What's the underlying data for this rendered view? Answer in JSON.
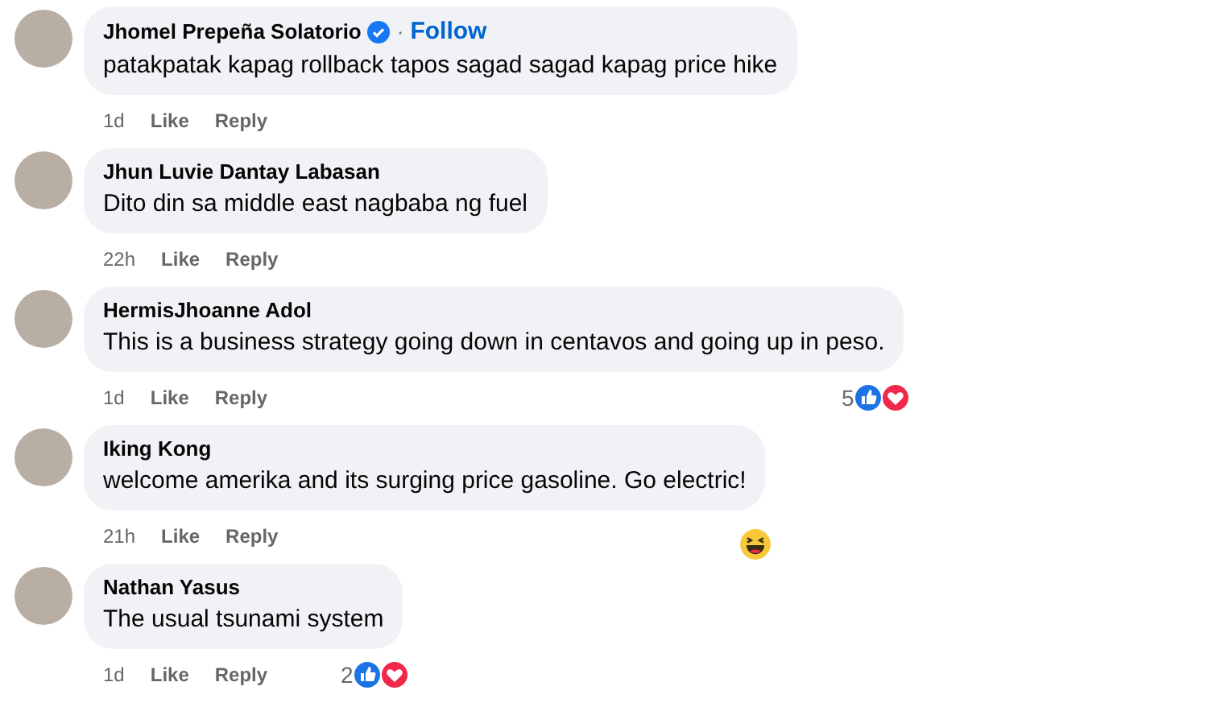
{
  "comments": [
    {
      "author": "Jhomel Prepeña Solatorio",
      "verified": true,
      "separator": "·",
      "follow": "Follow",
      "text": "patakpatak kapag rollback tapos sagad sagad kapag price hike",
      "time": "1d",
      "actions": [
        "Like",
        "Reply"
      ]
    },
    {
      "author": "Jhun Luvie Dantay Labasan",
      "verified": false,
      "text": "Dito din sa middle east nagbaba ng fuel",
      "time": "22h",
      "actions": [
        "Like",
        "Reply"
      ]
    },
    {
      "author": "HermisJhoanne Adol",
      "verified": false,
      "text": "This is a business strategy going down in centavos and going up in peso.",
      "time": "1d",
      "actions": [
        "Like",
        "Reply"
      ],
      "reactions": {
        "count": "5",
        "icons": [
          {
            "kind": "like"
          },
          {
            "kind": "love"
          }
        ]
      }
    },
    {
      "author": "Iking Kong",
      "verified": false,
      "text": "welcome amerika and its surging price gasoline. Go electric!",
      "time": "21h",
      "actions": [
        "Like",
        "Reply"
      ],
      "reactions": {
        "icons": [
          {
            "kind": "haha"
          }
        ]
      }
    },
    {
      "author": "Nathan Yasus",
      "verified": false,
      "text": "The usual tsunami system",
      "time": "1d",
      "actions": [
        "Like",
        "Reply"
      ],
      "reactions": {
        "count": "2",
        "icons": [
          {
            "kind": "like"
          },
          {
            "kind": "love"
          }
        ]
      }
    }
  ]
}
